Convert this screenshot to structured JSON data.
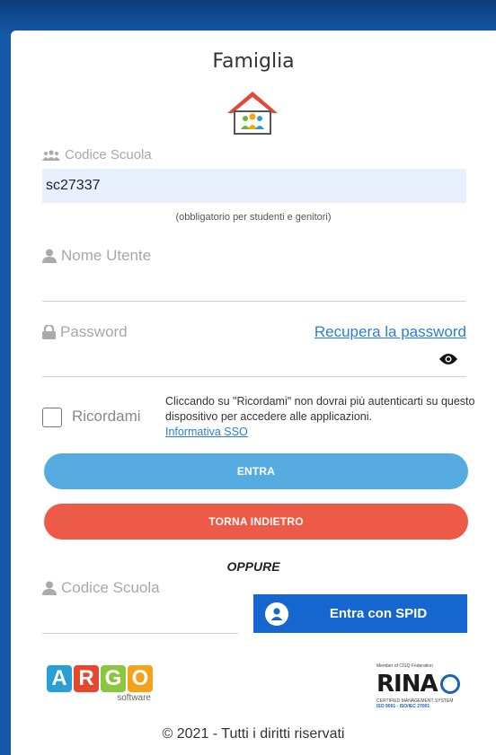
{
  "page": {
    "title": "Famiglia"
  },
  "school": {
    "label": "Codice Scuola",
    "value": "sc27337",
    "hint": "(obbligatorio per studenti e genitori)"
  },
  "username": {
    "label": "Nome Utente",
    "value": ""
  },
  "password": {
    "label": "Password",
    "value": "",
    "recover_link": "Recupera la password"
  },
  "remember": {
    "label": "Ricordami",
    "note": "Cliccando su \"Ricordami\" non dovrai più autenticarti su questo dispositivo per accedere alle applicazioni.",
    "link": "Informativa SSO"
  },
  "buttons": {
    "enter": "ENTRA",
    "back": "TORNA INDIETRO"
  },
  "divider": "OPPURE",
  "spid": {
    "school_label": "Codice Scuola",
    "school_value": "",
    "button": "Entra con SPID"
  },
  "argo": {
    "letters": [
      "A",
      "R",
      "G",
      "O"
    ],
    "letter_colors": [
      "#2a9fd6",
      "#e8472f",
      "#8cc63e",
      "#f5a21b"
    ],
    "sub": "software"
  },
  "rina": {
    "member": "Member of CISQ Federation",
    "word": "RINA",
    "certified": "CERTIFIED MANAGEMENT SYSTEM",
    "iso": "ISO 9001 - ISO/IEC 27001"
  },
  "footer": "© 2021 - Tutti i diritti riservati",
  "colors": {
    "enter": "#56ace0",
    "back": "#ee5a48",
    "spid": "#1666d0",
    "link": "#2a7fd4"
  }
}
